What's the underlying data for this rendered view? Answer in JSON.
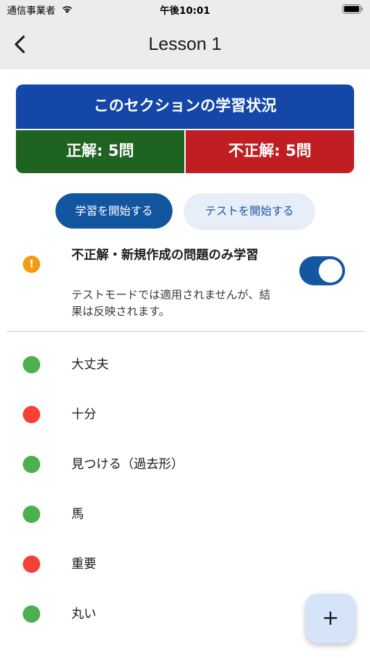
{
  "status_bar": {
    "carrier": "通信事業者",
    "time": "午後10:01"
  },
  "nav": {
    "title": "Lesson 1",
    "back_icon": "chevron-left-icon"
  },
  "progress_panel": {
    "header": "このセクションの学習状況",
    "correct_label": "正解: 5問",
    "incorrect_label": "不正解: 5問",
    "colors": {
      "header": "#1547a8",
      "correct": "#1f6321",
      "incorrect": "#c01e22"
    }
  },
  "actions": {
    "start_study": "学習を開始する",
    "start_test": "テストを開始する"
  },
  "filter": {
    "icon": "warning-icon",
    "label": "不正解・新規作成の問題のみ学習",
    "note": "テストモードでは適用されませんが、結果は反映されます。",
    "enabled": true
  },
  "words": [
    {
      "label": "大丈夫",
      "status": "correct",
      "color": "#4caf50"
    },
    {
      "label": "十分",
      "status": "incorrect",
      "color": "#f44336"
    },
    {
      "label": "見つける（過去形）",
      "status": "correct",
      "color": "#4caf50"
    },
    {
      "label": "馬",
      "status": "correct",
      "color": "#4caf50"
    },
    {
      "label": "重要",
      "status": "incorrect",
      "color": "#f44336"
    },
    {
      "label": "丸い",
      "status": "correct",
      "color": "#4caf50"
    }
  ],
  "fab": {
    "label": "+",
    "icon": "plus-icon"
  }
}
